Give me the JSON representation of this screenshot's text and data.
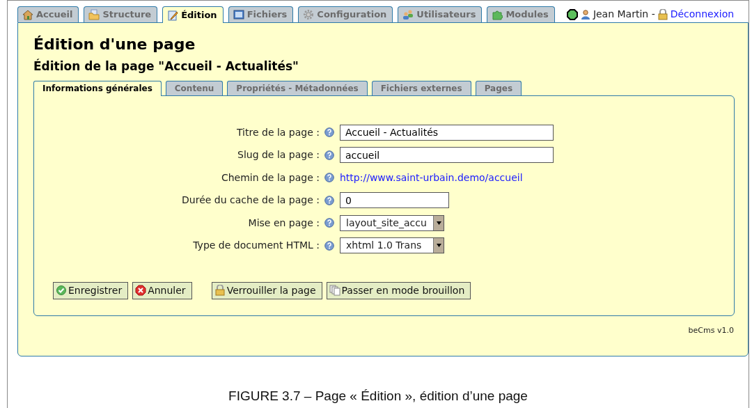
{
  "main_tabs": [
    {
      "label": "Accueil",
      "selected": false
    },
    {
      "label": "Structure",
      "selected": false
    },
    {
      "label": "Édition",
      "selected": true
    },
    {
      "label": "Fichiers",
      "selected": false
    },
    {
      "label": "Configuration",
      "selected": false
    },
    {
      "label": "Utilisateurs",
      "selected": false
    },
    {
      "label": "Modules",
      "selected": false
    }
  ],
  "user": {
    "name": "Jean Martin -",
    "logout": "Déconnexion"
  },
  "page_title": "Édition d'une page",
  "subtitle": "Édition de la page \"Accueil - Actualités\"",
  "sub_tabs": [
    {
      "label": "Informations générales",
      "selected": true
    },
    {
      "label": "Contenu",
      "selected": false
    },
    {
      "label": "Propriétés - Métadonnées",
      "selected": false
    },
    {
      "label": "Fichiers externes",
      "selected": false
    },
    {
      "label": "Pages",
      "selected": false
    }
  ],
  "fields": [
    {
      "kind": "text",
      "label": "Titre de la page :",
      "value": "Accueil - Actualités"
    },
    {
      "kind": "text",
      "label": "Slug de la page :",
      "value": "accueil"
    },
    {
      "kind": "link",
      "label": "Chemin de la page :",
      "value": "http://www.saint-urbain.demo/accueil"
    },
    {
      "kind": "short",
      "label": "Durée du cache de la page :",
      "value": "0"
    },
    {
      "kind": "select",
      "label": "Mise en page :",
      "value": "layout_site_accu"
    },
    {
      "kind": "select",
      "label": "Type de document HTML :",
      "value": "xhtml 1.0 Trans"
    }
  ],
  "buttons": [
    {
      "label": "Enregistrer",
      "kind": "ok"
    },
    {
      "label": "Annuler",
      "kind": "cancel"
    },
    {
      "label": "Verrouiller la page",
      "kind": "lock"
    },
    {
      "label": "Passer en mode brouillon",
      "kind": "copy"
    }
  ],
  "footer": "beCms v1.0",
  "caption": "FIGURE 3.7 – Page « Édition », édition d’une page"
}
